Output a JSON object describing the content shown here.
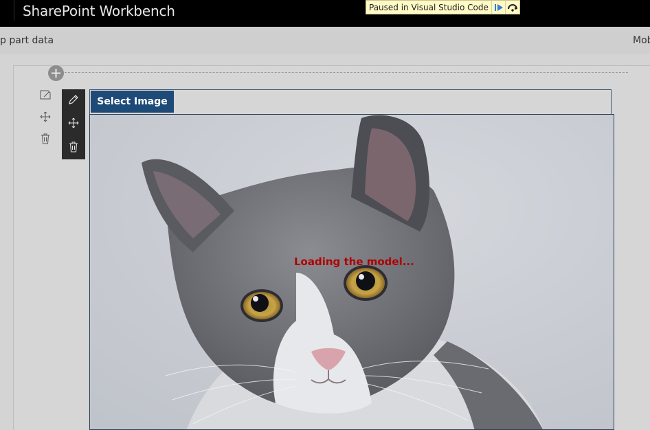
{
  "header": {
    "app_title": "SharePoint Workbench"
  },
  "debugger_banner": {
    "text": "Paused in Visual Studio Code",
    "resume_icon": "resume-icon",
    "step_over_icon": "step-over-icon"
  },
  "command_bar": {
    "left_label": "p part data",
    "right_label": "Mob"
  },
  "section_toolbar": {
    "icons": [
      "edit-section-icon",
      "move-section-icon",
      "delete-section-icon"
    ]
  },
  "webpart_toolbar": {
    "icons": [
      "edit-webpart-icon",
      "move-webpart-icon",
      "delete-webpart-icon"
    ]
  },
  "webpart": {
    "select_button_label": "Select Image",
    "status_text": "Loading the model...",
    "image_subject": "gray and white cat photo"
  },
  "colors": {
    "accent": "#1e4a78",
    "status_text": "#b00000",
    "banner_bg": "#fff9c6"
  }
}
